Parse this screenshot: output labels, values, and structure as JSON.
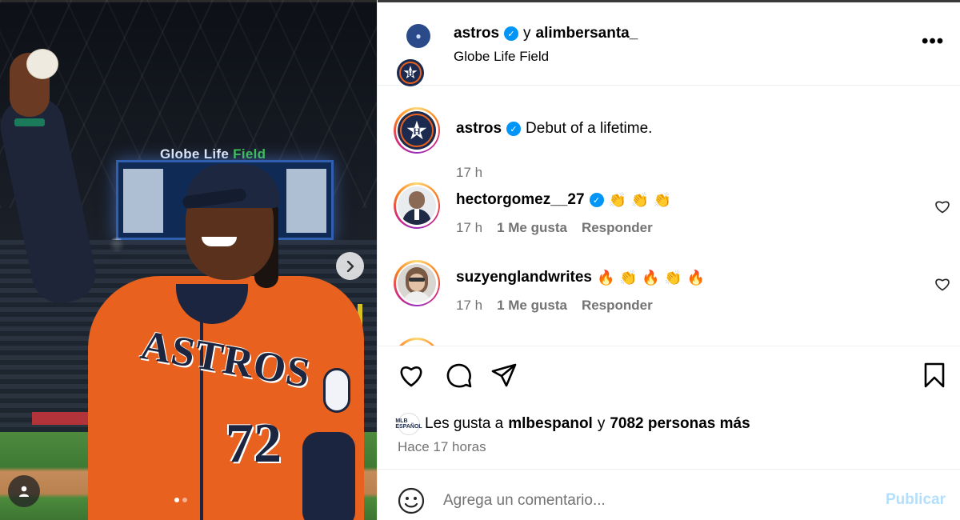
{
  "photo": {
    "scoreboard_text_prefix": "Globe Life ",
    "scoreboard_text_suffix": "Field",
    "jersey_text": "ASTROS",
    "jersey_number": "72",
    "next_icon": "chevron-right-icon",
    "tag_icon": "user-icon",
    "carousel": {
      "count": 2,
      "active_index": 0
    }
  },
  "header": {
    "account_primary": "astros",
    "connector": "y",
    "account_secondary": "alimbersanta_",
    "location": "Globe Life Field",
    "more_icon": "more-horizontal-icon",
    "more_label": "•••"
  },
  "caption": {
    "username": "astros",
    "text": "Debut of a lifetime.",
    "time": "17 h"
  },
  "comments": [
    {
      "username": "hectorgomez__27",
      "verified": true,
      "text": "👏 👏 👏",
      "time": "17 h",
      "likes": "1 Me gusta",
      "reply": "Responder"
    },
    {
      "username": "suzyenglandwrites",
      "verified": false,
      "text": "🔥 👏 🔥 👏 🔥",
      "time": "17 h",
      "likes": "1 Me gusta",
      "reply": "Responder"
    }
  ],
  "actions": {
    "like_icon": "heart-icon",
    "comment_icon": "comment-icon",
    "share_icon": "send-icon",
    "save_icon": "bookmark-icon"
  },
  "likes": {
    "prefix": "Les gusta a",
    "user": "mlbespanol",
    "connector": "y",
    "others": "7082 personas más",
    "mini_logo": "MLB ESPAÑOL"
  },
  "time_ago": "Hace 17 horas",
  "comment_box": {
    "placeholder": "Agrega un comentario...",
    "value": "",
    "publish_label": "Publicar"
  },
  "colors": {
    "verified": "#0095f6",
    "publish_disabled": "#b2dffc",
    "astros_navy": "#1b2a4e",
    "astros_orange": "#e8611e"
  }
}
